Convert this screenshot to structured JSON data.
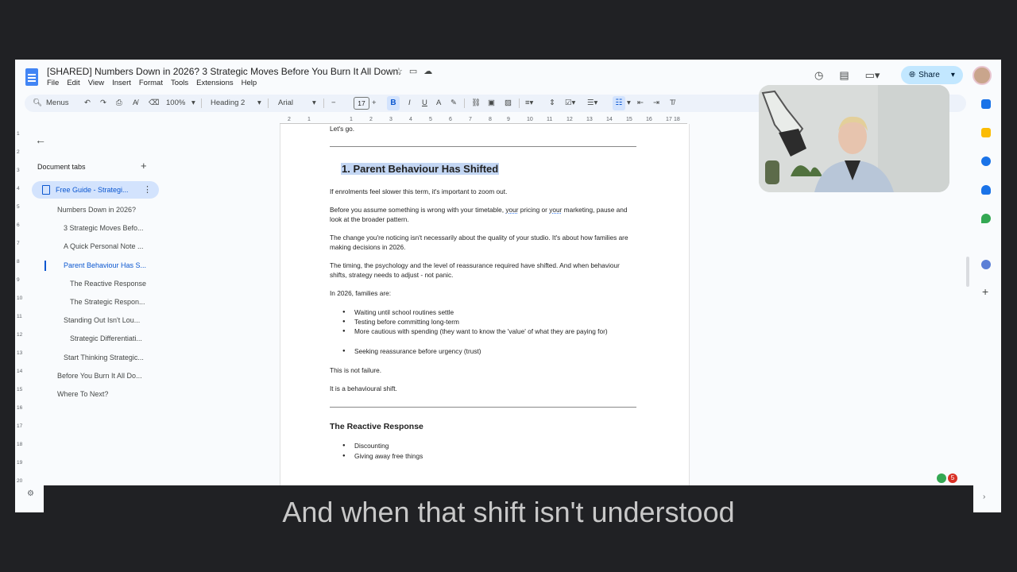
{
  "doc_title": "[SHARED] Numbers Down in 2026? 3 Strategic Moves Before You Burn It All Down.",
  "menu": [
    "File",
    "Edit",
    "View",
    "Insert",
    "Format",
    "Tools",
    "Extensions",
    "Help"
  ],
  "share_label": "Share",
  "toolbar": {
    "menus_label": "Menus",
    "zoom": "100%",
    "style": "Heading 2",
    "font": "Arial",
    "font_size": "17",
    "bold": "B",
    "italic": "I",
    "underline": "U"
  },
  "sidebar": {
    "header": "Document tabs",
    "tab_label": "Free Guide - Strategi...",
    "outline": [
      "Numbers Down in 2026?",
      "3 Strategic Moves Befo...",
      "A Quick Personal Note ...",
      "Parent Behaviour Has S...",
      "The Reactive Response",
      "The Strategic Respon...",
      "Standing Out Isn't Lou...",
      "Strategic Differentiati...",
      "Start Thinking Strategic...",
      "Before You Burn It All Do...",
      "Where To Next?"
    ]
  },
  "ruler": [
    "2",
    "1",
    "1",
    "2",
    "3",
    "4",
    "5",
    "6",
    "7",
    "8",
    "9",
    "10",
    "11",
    "12",
    "13",
    "14",
    "15",
    "16",
    "17",
    "18"
  ],
  "vruler": [
    "1",
    "2",
    "3",
    "4",
    "5",
    "6",
    "7",
    "8",
    "9",
    "10",
    "11",
    "12",
    "13",
    "14",
    "15",
    "16",
    "17",
    "18",
    "19",
    "20"
  ],
  "page": {
    "top_text": "Let's go.",
    "heading": "1. Parent Behaviour Has Shifted",
    "p1": "If enrolments feel slower this term, it's important to zoom out.",
    "p2_a": "Before you assume something is wrong with your timetable, ",
    "p2_u1": "your",
    "p2_b": " pricing or ",
    "p2_u2": "your",
    "p2_c": " marketing, pause and look at the broader pattern.",
    "p3": "The change you're noticing isn't necessarily about the quality of your studio. It's about how families are making decisions in 2026.",
    "p4": "The timing, the psychology and the level of reassurance required have shifted. And when behaviour shifts, strategy needs to adjust - not panic.",
    "p5": "In 2026, families are:",
    "bullets": [
      "Waiting until school routines settle",
      "Testing before committing long-term",
      "More cautious with spending (they want to know the 'value' of what they are paying for)",
      "Seeking reassurance before urgency (trust)"
    ],
    "p6": "This is not failure.",
    "p7": "It is a behavioural shift.",
    "heading2": "The Reactive Response",
    "bullets2": [
      "Discounting",
      "Giving away free things"
    ]
  },
  "badge_count": "5",
  "caption": "And when that shift isn't understood"
}
